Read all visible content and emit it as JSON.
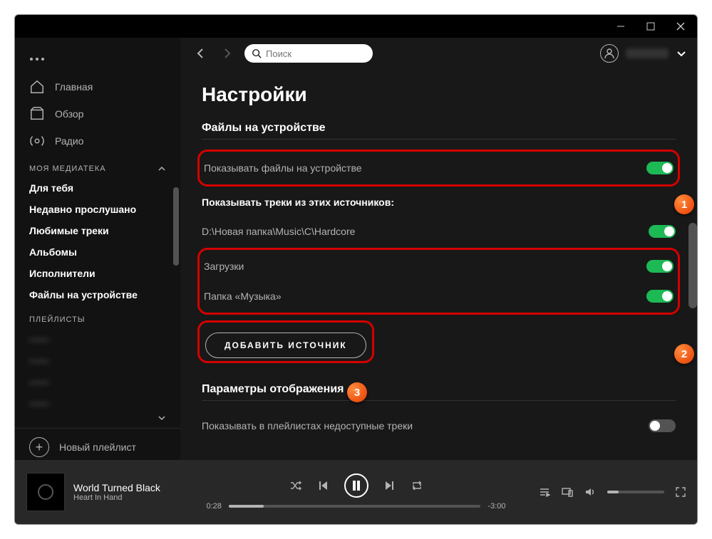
{
  "window": {
    "title": ""
  },
  "sidebar": {
    "nav": [
      {
        "label": "Главная",
        "icon": "home"
      },
      {
        "label": "Обзор",
        "icon": "browse"
      },
      {
        "label": "Радио",
        "icon": "radio"
      }
    ],
    "library_header": "МОЯ МЕДИАТЕКА",
    "library": [
      "Для тебя",
      "Недавно прослушано",
      "Любимые треки",
      "Альбомы",
      "Исполнители",
      "Файлы на устройстве"
    ],
    "playlists_header": "ПЛЕЙЛИСТЫ",
    "playlists": [
      "——",
      "——",
      "——",
      "——"
    ],
    "new_playlist": "Новый плейлист"
  },
  "top": {
    "search_placeholder": "Поиск"
  },
  "page": {
    "title": "Настройки",
    "section_local": "Файлы на устройстве",
    "show_local": "Показывать файлы на устройстве",
    "sources_label": "Показывать треки из этих источников:",
    "sources": [
      {
        "path": "D:\\Новая папка\\Music\\C\\Hardcore",
        "on": true
      },
      {
        "path": "Загрузки",
        "on": true
      },
      {
        "path": "Папка «Музыка»",
        "on": true
      }
    ],
    "add_source": "ДОБАВИТЬ ИСТОЧНИК",
    "section_display": "Параметры отображения",
    "unavailable": "Показывать в плейлистах недоступные треки"
  },
  "player": {
    "title": "World Turned Black",
    "artist": "Heart In Hand",
    "elapsed": "0:28",
    "remaining": "-3:00"
  },
  "badges": {
    "b1": "1",
    "b2": "2",
    "b3": "3"
  }
}
